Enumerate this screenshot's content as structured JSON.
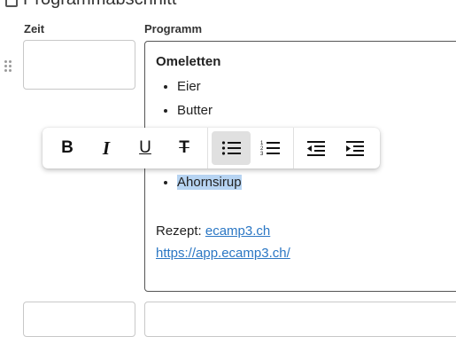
{
  "header": {
    "title": "Programmabschnitt"
  },
  "labels": {
    "time": "Zeit",
    "program": "Programm"
  },
  "editor": {
    "title": "Omeletten",
    "list_items": [
      "Eier",
      "Butter"
    ],
    "highlighted_item": "Ahornsirup",
    "recipe_prefix": "Rezept: ",
    "recipe_link": "ecamp3.ch",
    "url_link": "https://app.ecamp3.ch/"
  },
  "toolbar": {
    "bold": "B",
    "italic": "I",
    "underline": "U",
    "strike": "T",
    "active_button": "bullet-list"
  },
  "colors": {
    "highlight": "#b7d4f2",
    "link": "#2b77c4",
    "active_button_bg": "#e0e0e0"
  }
}
